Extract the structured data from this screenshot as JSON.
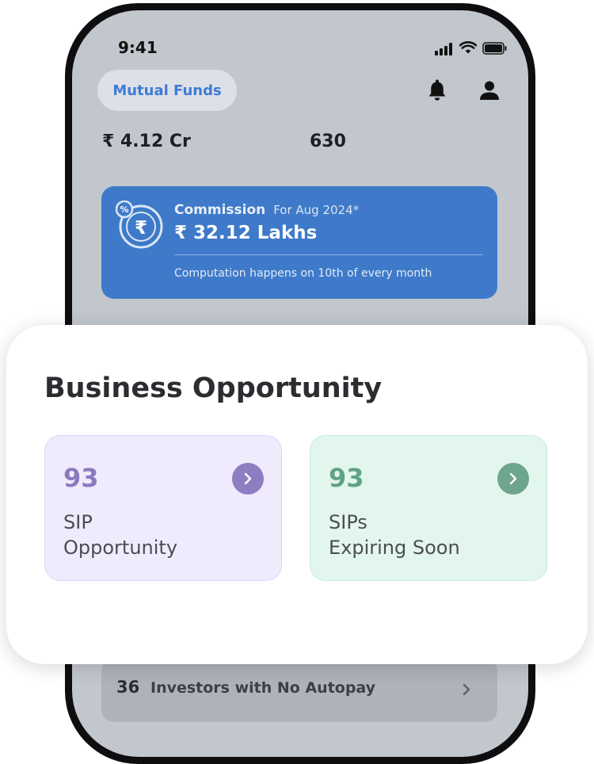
{
  "status_bar": {
    "time": "9:41"
  },
  "header": {
    "chip_label": "Mutual Funds",
    "icons": [
      "bell-icon",
      "user-icon"
    ]
  },
  "summary": {
    "aum": "₹ 4.12 Cr",
    "count": "630"
  },
  "commission": {
    "title": "Commission",
    "period": "For Aug 2024*",
    "value": "₹ 32.12 Lakhs",
    "note": "Computation happens on 10th of every month",
    "icon": "rupee-percent-icon"
  },
  "business_opportunity": {
    "title": "Business Opportunity",
    "tiles": [
      {
        "count": "93",
        "label_line1": "SIP",
        "label_line2": "Opportunity",
        "color": "#8c7ec1"
      },
      {
        "count": "93",
        "label_line1": "SIPs",
        "label_line2": "Expiring Soon",
        "color": "#6ea58d"
      }
    ]
  },
  "autopay": {
    "count": "36",
    "label": "Investors with No Autopay"
  },
  "colors": {
    "accent": "#3e7ac9",
    "screen_bg": "#c2c6cd"
  }
}
